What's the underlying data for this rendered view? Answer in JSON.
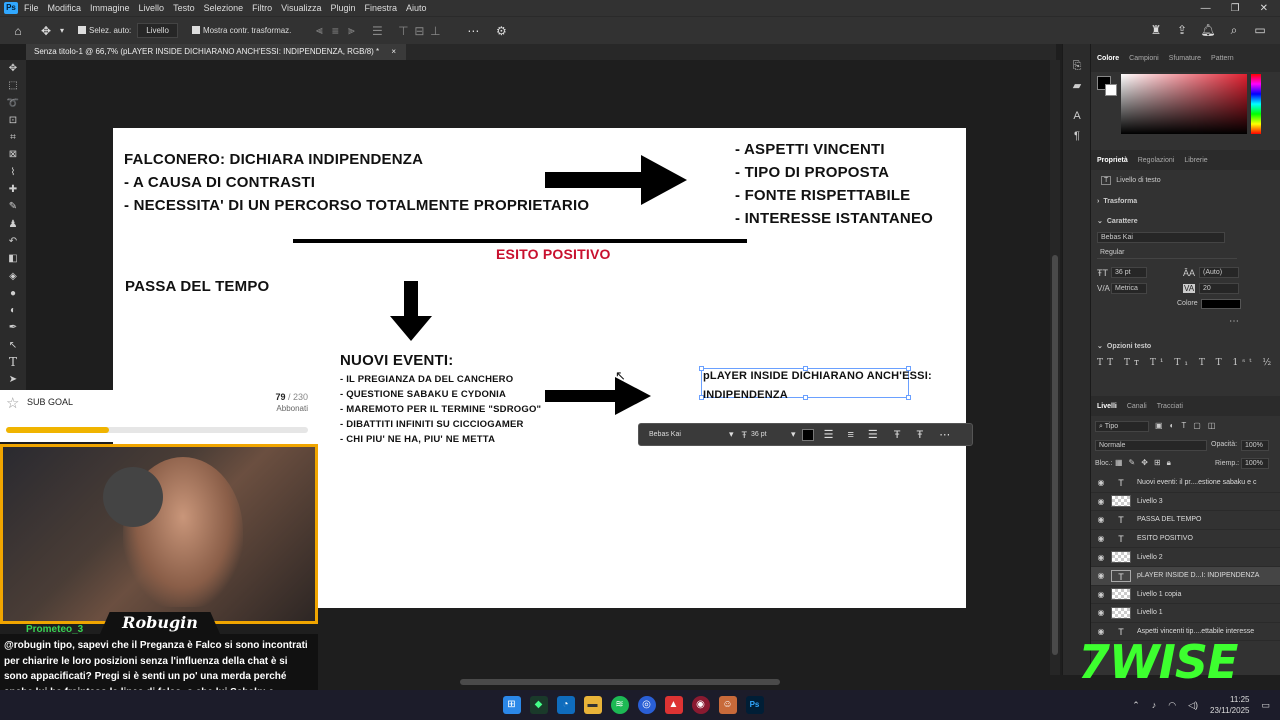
{
  "menu": [
    "File",
    "Modifica",
    "Immagine",
    "Livello",
    "Testo",
    "Selezione",
    "Filtro",
    "Visualizza",
    "Plugin",
    "Finestra",
    "Aiuto"
  ],
  "options": {
    "auto_select": "Selez. auto:",
    "layer_select": "Livello",
    "show_transform": "Mostra contr. trasformaz."
  },
  "tab": {
    "title": "Senza titolo-1 @ 66,7% (pLAYER INSIDE DICHIARANO ANCH'ESSI: INDIPENDENZA, RGB/8) *",
    "close": "×"
  },
  "doc": {
    "left_block": [
      "FALCONERO: DICHIARA INDIPENDENZA",
      "-  A CAUSA DI CONTRASTI",
      "-  NECESSITA' DI UN PERCORSO TOTALMENTE PROPRIETARIO"
    ],
    "right_block": [
      "-  ASPETTI VINCENTI",
      "-  TIPO DI PROPOSTA",
      "-  FONTE RISPETTABILE",
      "-  INTERESSE ISTANTANEO"
    ],
    "esito": "ESITO POSITIVO",
    "passa": "PASSA DEL TEMPO",
    "nuovi_title": "NUOVI EVENTI:",
    "nuovi_items": [
      "-  IL PREGIANZA DA DEL CANCHERO",
      "-  QUESTIONE SABAKU E CYDONIA",
      "-  MAREMOTO PER IL TERMINE \"SDROGO\"",
      "-  DIBATTITI INFINITI SU CICCIOGAMER",
      "-  CHI PIU' NE HA, PIU' NE METTA"
    ],
    "selected_text": [
      "pLAYER INSIDE DICHIARANO ANCH'ESSI:",
      "INDIPENDENZA"
    ]
  },
  "text_toolbar": {
    "font": "Bebas Kai",
    "size": "36 pt"
  },
  "panels": {
    "color_tabs": [
      "Colore",
      "Campioni",
      "Sfumature",
      "Pattern"
    ],
    "prop_tabs": [
      "Proprietà",
      "Regolazioni",
      "Librerie"
    ],
    "layer_type": "Livello di testo",
    "trasform": "Trasforma",
    "carattere": "Carattere",
    "font": "Bebas Kai",
    "style": "Regular",
    "size": "36 pt",
    "leading": "(Auto)",
    "kerning": "Metrica",
    "tracking": "20",
    "color_label": "Colore",
    "opzioni": "Opzioni testo",
    "layer_tabs": [
      "Livelli",
      "Canali",
      "Tracciati"
    ],
    "filter": "Tipo",
    "blend": "Normale",
    "opacity_label": "Opacità:",
    "opacity": "100%",
    "lock_label": "Bloc.:",
    "fill_label": "Riemp.:",
    "fill": "100%",
    "layers": [
      {
        "name": "Nuovi eventi: il pr....estione sabaku e c",
        "kind": "text"
      },
      {
        "name": "Livello 3",
        "kind": "pixel"
      },
      {
        "name": "PASSA DEL TEMPO",
        "kind": "text"
      },
      {
        "name": "ESITO POSITIVO",
        "kind": "text"
      },
      {
        "name": "Livello 2",
        "kind": "pixel"
      },
      {
        "name": "pLAYER INSIDE D...I: INDIPENDENZA",
        "kind": "text",
        "selected": true
      },
      {
        "name": "Livello 1 copia",
        "kind": "pixel"
      },
      {
        "name": "Livello 1",
        "kind": "pixel"
      },
      {
        "name": "Aspetti vincenti tip....ettabile interesse",
        "kind": "text"
      }
    ]
  },
  "stream": {
    "sub_goal_label": "SUB GOAL",
    "sub_count": "79",
    "sub_total": "/ 230",
    "sub_unit": "Abbonati",
    "sub_progress": 0.34,
    "streamer": "Robugin",
    "chat_user": "Prometeo_3",
    "chat_message": "@robugin tipo, sapevi che il Preganza è Falco si sono incontrati per chiarire le loro posizioni senza l'influenza della chat è si sono appacificati? Pregi si è senti un po' una merda perché anche lui ha frainteso la linea di falco. o che lui Sabaku e Playerinside si conoscono e sono amici?",
    "brand": "7WISE"
  },
  "taskbar": {
    "time": "11:25",
    "date": "23/11/2025"
  }
}
